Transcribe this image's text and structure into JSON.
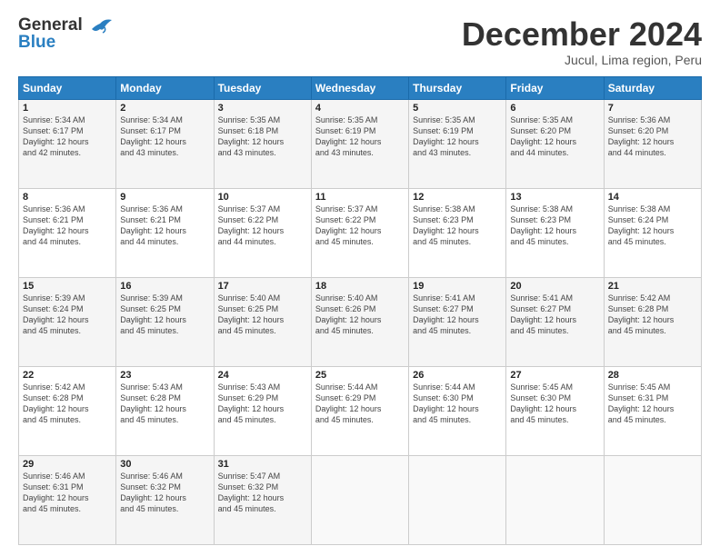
{
  "header": {
    "logo_line1": "General",
    "logo_line2": "Blue",
    "month": "December 2024",
    "location": "Jucul, Lima region, Peru"
  },
  "weekdays": [
    "Sunday",
    "Monday",
    "Tuesday",
    "Wednesday",
    "Thursday",
    "Friday",
    "Saturday"
  ],
  "weeks": [
    [
      {
        "day": "1",
        "info": "Sunrise: 5:34 AM\nSunset: 6:17 PM\nDaylight: 12 hours\nand 42 minutes."
      },
      {
        "day": "2",
        "info": "Sunrise: 5:34 AM\nSunset: 6:17 PM\nDaylight: 12 hours\nand 43 minutes."
      },
      {
        "day": "3",
        "info": "Sunrise: 5:35 AM\nSunset: 6:18 PM\nDaylight: 12 hours\nand 43 minutes."
      },
      {
        "day": "4",
        "info": "Sunrise: 5:35 AM\nSunset: 6:19 PM\nDaylight: 12 hours\nand 43 minutes."
      },
      {
        "day": "5",
        "info": "Sunrise: 5:35 AM\nSunset: 6:19 PM\nDaylight: 12 hours\nand 43 minutes."
      },
      {
        "day": "6",
        "info": "Sunrise: 5:35 AM\nSunset: 6:20 PM\nDaylight: 12 hours\nand 44 minutes."
      },
      {
        "day": "7",
        "info": "Sunrise: 5:36 AM\nSunset: 6:20 PM\nDaylight: 12 hours\nand 44 minutes."
      }
    ],
    [
      {
        "day": "8",
        "info": "Sunrise: 5:36 AM\nSunset: 6:21 PM\nDaylight: 12 hours\nand 44 minutes."
      },
      {
        "day": "9",
        "info": "Sunrise: 5:36 AM\nSunset: 6:21 PM\nDaylight: 12 hours\nand 44 minutes."
      },
      {
        "day": "10",
        "info": "Sunrise: 5:37 AM\nSunset: 6:22 PM\nDaylight: 12 hours\nand 44 minutes."
      },
      {
        "day": "11",
        "info": "Sunrise: 5:37 AM\nSunset: 6:22 PM\nDaylight: 12 hours\nand 45 minutes."
      },
      {
        "day": "12",
        "info": "Sunrise: 5:38 AM\nSunset: 6:23 PM\nDaylight: 12 hours\nand 45 minutes."
      },
      {
        "day": "13",
        "info": "Sunrise: 5:38 AM\nSunset: 6:23 PM\nDaylight: 12 hours\nand 45 minutes."
      },
      {
        "day": "14",
        "info": "Sunrise: 5:38 AM\nSunset: 6:24 PM\nDaylight: 12 hours\nand 45 minutes."
      }
    ],
    [
      {
        "day": "15",
        "info": "Sunrise: 5:39 AM\nSunset: 6:24 PM\nDaylight: 12 hours\nand 45 minutes."
      },
      {
        "day": "16",
        "info": "Sunrise: 5:39 AM\nSunset: 6:25 PM\nDaylight: 12 hours\nand 45 minutes."
      },
      {
        "day": "17",
        "info": "Sunrise: 5:40 AM\nSunset: 6:25 PM\nDaylight: 12 hours\nand 45 minutes."
      },
      {
        "day": "18",
        "info": "Sunrise: 5:40 AM\nSunset: 6:26 PM\nDaylight: 12 hours\nand 45 minutes."
      },
      {
        "day": "19",
        "info": "Sunrise: 5:41 AM\nSunset: 6:27 PM\nDaylight: 12 hours\nand 45 minutes."
      },
      {
        "day": "20",
        "info": "Sunrise: 5:41 AM\nSunset: 6:27 PM\nDaylight: 12 hours\nand 45 minutes."
      },
      {
        "day": "21",
        "info": "Sunrise: 5:42 AM\nSunset: 6:28 PM\nDaylight: 12 hours\nand 45 minutes."
      }
    ],
    [
      {
        "day": "22",
        "info": "Sunrise: 5:42 AM\nSunset: 6:28 PM\nDaylight: 12 hours\nand 45 minutes."
      },
      {
        "day": "23",
        "info": "Sunrise: 5:43 AM\nSunset: 6:28 PM\nDaylight: 12 hours\nand 45 minutes."
      },
      {
        "day": "24",
        "info": "Sunrise: 5:43 AM\nSunset: 6:29 PM\nDaylight: 12 hours\nand 45 minutes."
      },
      {
        "day": "25",
        "info": "Sunrise: 5:44 AM\nSunset: 6:29 PM\nDaylight: 12 hours\nand 45 minutes."
      },
      {
        "day": "26",
        "info": "Sunrise: 5:44 AM\nSunset: 6:30 PM\nDaylight: 12 hours\nand 45 minutes."
      },
      {
        "day": "27",
        "info": "Sunrise: 5:45 AM\nSunset: 6:30 PM\nDaylight: 12 hours\nand 45 minutes."
      },
      {
        "day": "28",
        "info": "Sunrise: 5:45 AM\nSunset: 6:31 PM\nDaylight: 12 hours\nand 45 minutes."
      }
    ],
    [
      {
        "day": "29",
        "info": "Sunrise: 5:46 AM\nSunset: 6:31 PM\nDaylight: 12 hours\nand 45 minutes."
      },
      {
        "day": "30",
        "info": "Sunrise: 5:46 AM\nSunset: 6:32 PM\nDaylight: 12 hours\nand 45 minutes."
      },
      {
        "day": "31",
        "info": "Sunrise: 5:47 AM\nSunset: 6:32 PM\nDaylight: 12 hours\nand 45 minutes."
      },
      {
        "day": "",
        "info": ""
      },
      {
        "day": "",
        "info": ""
      },
      {
        "day": "",
        "info": ""
      },
      {
        "day": "",
        "info": ""
      }
    ]
  ]
}
